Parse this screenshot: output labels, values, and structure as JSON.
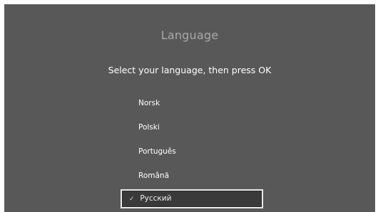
{
  "title": "Language",
  "subtitle": "Select your language, then press OK",
  "languages": [
    {
      "label": "Norsk"
    },
    {
      "label": "Polski"
    },
    {
      "label": "Português"
    },
    {
      "label": "Română"
    },
    {
      "label": "Русский",
      "selected": true
    }
  ],
  "check_icon": "✓",
  "colors": {
    "panel": "#585858",
    "title": "#a9a9a9",
    "text": "#ffffff",
    "focus_border": "#e9e9e9",
    "focus_fill": "#3a3a3a"
  }
}
